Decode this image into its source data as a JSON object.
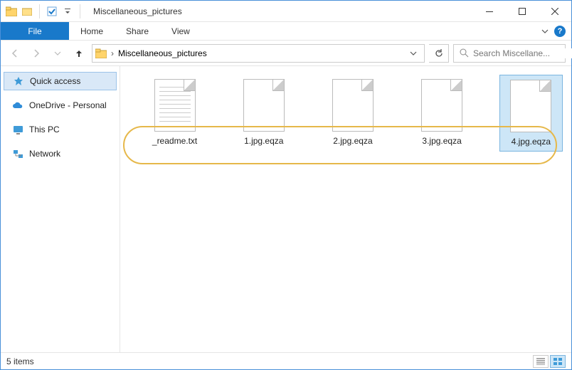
{
  "window": {
    "title": "Miscellaneous_pictures"
  },
  "menu": {
    "file": "File",
    "home": "Home",
    "share": "Share",
    "view": "View"
  },
  "address": {
    "folder": "Miscellaneous_pictures",
    "separator": "›"
  },
  "search": {
    "placeholder": "Search Miscellane..."
  },
  "sidebar": {
    "quick_access": "Quick access",
    "onedrive": "OneDrive - Personal",
    "this_pc": "This PC",
    "network": "Network"
  },
  "files": [
    {
      "name": "_readme.txt",
      "type": "text",
      "selected": false
    },
    {
      "name": "1.jpg.eqza",
      "type": "generic",
      "selected": false
    },
    {
      "name": "2.jpg.eqza",
      "type": "generic",
      "selected": false
    },
    {
      "name": "3.jpg.eqza",
      "type": "generic",
      "selected": false
    },
    {
      "name": "4.jpg.eqza",
      "type": "generic",
      "selected": true
    }
  ],
  "status": {
    "item_count": "5 items"
  },
  "help": {
    "glyph": "?"
  }
}
